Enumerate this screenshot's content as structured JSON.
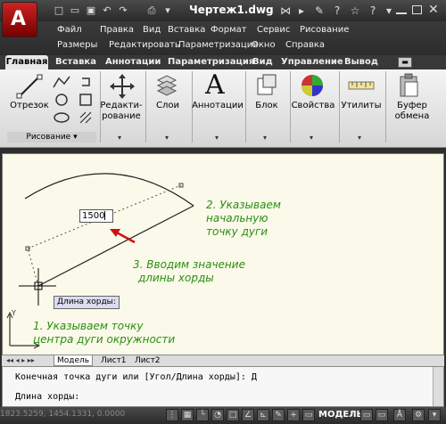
{
  "window": {
    "title": "Чертеж1.dwg",
    "app_glyph": "A"
  },
  "quick_access": [
    "□",
    "▭",
    "▣",
    "↶",
    "↷",
    "⎙",
    "▾"
  ],
  "title_right": [
    "⋈",
    "▸",
    "✎",
    "?",
    "☆",
    "?",
    "▾"
  ],
  "menu": {
    "row1": [
      "Файл",
      "Правка",
      "Вид",
      "Вставка",
      "Формат",
      "Сервис",
      "Рисование"
    ],
    "row2": [
      "Размеры",
      "Редактировать",
      "Параметризация",
      "Окно",
      "Справка"
    ]
  },
  "ribbon_tabs": [
    "Главная",
    "Вставка",
    "Аннотации",
    "Параметризация",
    "Вид",
    "Управление",
    "Вывод"
  ],
  "ribbon": {
    "draw_group": {
      "line_label": "Отрезок",
      "panel_label": "Рисование"
    },
    "modify_label_1": "Редакти-",
    "modify_label_2": "рование",
    "layers_label": "Слои",
    "annotations_label": "Аннотации",
    "annotations_glyph": "A",
    "block_label": "Блок",
    "properties_label": "Свойства",
    "utilities_label": "Утилиты",
    "clipboard_label_1": "Буфер",
    "clipboard_label_2": "обмена"
  },
  "canvas": {
    "input_value": "1500",
    "tooltip": "Длина хорды:",
    "annotation_1_line1": "1. Указываем точку",
    "annotation_1_line2": "центра дуги окружности",
    "annotation_2_line1": "2. Указываем",
    "annotation_2_line2": "начальную",
    "annotation_2_line3": "точку дуги",
    "annotation_3_line1": "3. Вводим значение",
    "annotation_3_line2": "длины хорды",
    "ucs_x": "X",
    "ucs_y": "Y",
    "colors": {
      "background": "#fbf9e9",
      "annotation": "#2a8f12",
      "arrow": "#d01010"
    }
  },
  "layout_tabs": [
    "Модель",
    "Лист1",
    "Лист2"
  ],
  "command": {
    "history": "Конечная точка дуги или [Угол/Длина хорды]: Д",
    "prompt": "Длина хорды:"
  },
  "status": {
    "coords": "1823.5259, 1454.1331, 0.0000",
    "model": "МОДЕЛЬ"
  }
}
